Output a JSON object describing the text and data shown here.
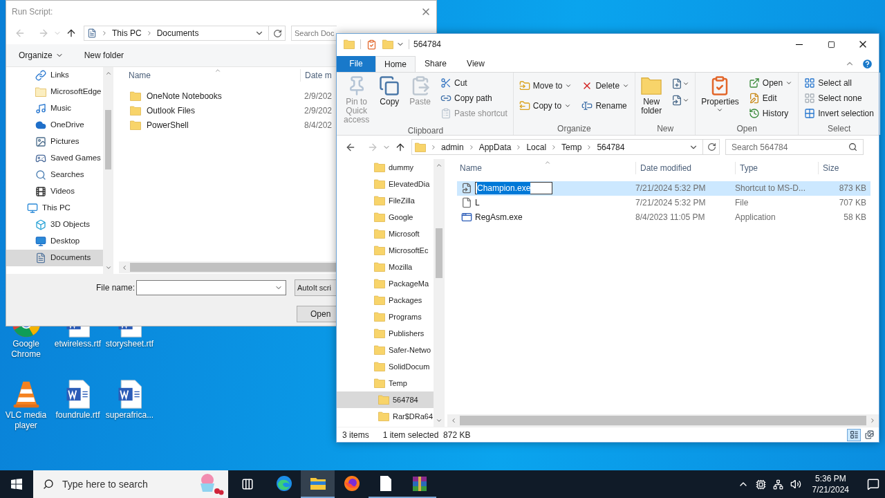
{
  "desktop_icons": [
    {
      "label": "Google Chrome",
      "kind": "chrome"
    },
    {
      "label": "etwireless.rtf",
      "kind": "document"
    },
    {
      "label": "storysheet.rtf",
      "kind": "document"
    },
    {
      "label": "VLC media player",
      "kind": "vlc"
    },
    {
      "label": "foundrule.rtf",
      "kind": "document"
    },
    {
      "label": "superafrica...",
      "kind": "document"
    }
  ],
  "run_dialog": {
    "title": "Run Script:",
    "path": [
      "This PC",
      "Documents"
    ],
    "search_placeholder": "Search Doc",
    "toolbar": [
      {
        "label": "Organize",
        "menu": true
      },
      {
        "label": "New folder",
        "menu": false
      }
    ],
    "nav": [
      {
        "label": "Links",
        "selected": false
      },
      {
        "label": "MicrosoftEdge",
        "selected": false
      },
      {
        "label": "Music",
        "selected": false
      },
      {
        "label": "OneDrive",
        "selected": false
      },
      {
        "label": "Pictures",
        "selected": false
      },
      {
        "label": "Saved Games",
        "selected": false
      },
      {
        "label": "Searches",
        "selected": false
      },
      {
        "label": "Videos",
        "selected": false
      },
      {
        "label": "This PC",
        "selected": false,
        "children": [
          {
            "label": "3D Objects",
            "selected": false
          },
          {
            "label": "Desktop",
            "selected": false
          },
          {
            "label": "Documents",
            "selected": true
          }
        ]
      }
    ],
    "columns": [
      "Name",
      "Date m"
    ],
    "files": [
      {
        "name": "OneNote Notebooks",
        "date": "2/9/202"
      },
      {
        "name": "Outlook Files",
        "date": "2/9/202"
      },
      {
        "name": "PowerShell",
        "date": "8/4/202"
      }
    ],
    "file_name_label": "File name:",
    "filter": "AutoIt scri",
    "buttons": [
      "Open"
    ]
  },
  "explorer": {
    "title": "564784",
    "tabs": [
      {
        "label": "File",
        "kind": "file",
        "selected": false
      },
      {
        "label": "Home",
        "kind": "tab",
        "selected": true
      },
      {
        "label": "Share",
        "kind": "tab",
        "selected": false
      },
      {
        "label": "View",
        "kind": "tab",
        "selected": false
      }
    ],
    "ribbon": [
      {
        "label": "Clipboard",
        "commands": [
          {
            "label": "Pin to Quick access",
            "kind": "large",
            "menu": false,
            "disabled": true
          },
          {
            "label": "Copy",
            "kind": "large",
            "menu": false,
            "disabled": false
          },
          {
            "label": "Paste",
            "kind": "large",
            "menu": false,
            "disabled": true
          },
          {
            "label": "Cut",
            "kind": "small",
            "menu": false,
            "disabled": false
          },
          {
            "label": "Copy path",
            "kind": "small",
            "menu": false,
            "disabled": false
          },
          {
            "label": "Paste shortcut",
            "kind": "small",
            "menu": false,
            "disabled": true
          }
        ]
      },
      {
        "label": "Organize",
        "commands": [
          {
            "label": "Move to",
            "kind": "small",
            "menu": true,
            "disabled": false
          },
          {
            "label": "Copy to",
            "kind": "small",
            "menu": true,
            "disabled": false
          },
          {
            "label": "Delete",
            "kind": "small",
            "menu": true,
            "disabled": false
          },
          {
            "label": "Rename",
            "kind": "small",
            "menu": false,
            "disabled": false
          }
        ]
      },
      {
        "label": "New",
        "commands": [
          {
            "label": "New folder",
            "kind": "large",
            "menu": false,
            "disabled": false
          },
          {
            "kind": "icon",
            "menu": true,
            "disabled": false
          },
          {
            "kind": "icon",
            "menu": true,
            "disabled": false
          }
        ]
      },
      {
        "label": "Open",
        "commands": [
          {
            "label": "Properties",
            "kind": "large",
            "menu": true,
            "disabled": false
          },
          {
            "label": "Open",
            "kind": "small",
            "menu": true,
            "disabled": false
          },
          {
            "label": "Edit",
            "kind": "small",
            "menu": false,
            "disabled": false
          },
          {
            "label": "History",
            "kind": "small",
            "menu": false,
            "disabled": false
          }
        ]
      },
      {
        "label": "Select",
        "commands": [
          {
            "label": "Select all",
            "kind": "small",
            "menu": false,
            "disabled": false
          },
          {
            "label": "Select none",
            "kind": "small",
            "menu": false,
            "disabled": false
          },
          {
            "label": "Invert selection",
            "kind": "small",
            "menu": false,
            "disabled": false
          }
        ]
      }
    ],
    "path": [
      "admin",
      "AppData",
      "Local",
      "Temp",
      "564784"
    ],
    "search_placeholder": "Search 564784",
    "tree": [
      {
        "label": "dummy",
        "selected": false
      },
      {
        "label": "ElevatedDia",
        "selected": false
      },
      {
        "label": "FileZilla",
        "selected": false
      },
      {
        "label": "Google",
        "selected": false
      },
      {
        "label": "Microsoft",
        "selected": false
      },
      {
        "label": "MicrosoftEc",
        "selected": false
      },
      {
        "label": "Mozilla",
        "selected": false
      },
      {
        "label": "PackageMa",
        "selected": false
      },
      {
        "label": "Packages",
        "selected": false
      },
      {
        "label": "Programs",
        "selected": false
      },
      {
        "label": "Publishers",
        "selected": false
      },
      {
        "label": "Safer-Netwo",
        "selected": false
      },
      {
        "label": "SolidDocum",
        "selected": false
      },
      {
        "label": "Temp",
        "selected": false,
        "children": [
          {
            "label": "564784",
            "selected": true
          },
          {
            "label": "Rar$DRa64",
            "selected": false
          }
        ]
      }
    ],
    "columns": [
      "Name",
      "Date modified",
      "Type",
      "Size"
    ],
    "files": [
      {
        "name": "Champion.exe",
        "date": "7/21/2024 5:32 PM",
        "type": "Shortcut to MS-D...",
        "size": "873 KB",
        "kind": "shortcut",
        "selected": true
      },
      {
        "name": "L",
        "date": "7/21/2024 5:32 PM",
        "type": "File",
        "size": "707 KB",
        "kind": "file",
        "selected": false
      },
      {
        "name": "RegAsm.exe",
        "date": "8/4/2023 11:05 PM",
        "type": "Application",
        "size": "58 KB",
        "kind": "application",
        "selected": false
      }
    ],
    "status": {
      "count": "3 items",
      "selection": "1 item selected  872 KB"
    }
  },
  "taskbar": {
    "search_placeholder": "Type here to search",
    "apps": [
      {
        "kind": "edge",
        "open": false,
        "selected": false
      },
      {
        "kind": "explorer",
        "open": true,
        "selected": true
      },
      {
        "kind": "firefox",
        "open": false,
        "selected": false
      },
      {
        "kind": "notepad",
        "open": true,
        "selected": false
      },
      {
        "kind": "winrar",
        "open": true,
        "selected": false
      }
    ],
    "time": "5:36 PM",
    "date": "7/21/2024"
  }
}
